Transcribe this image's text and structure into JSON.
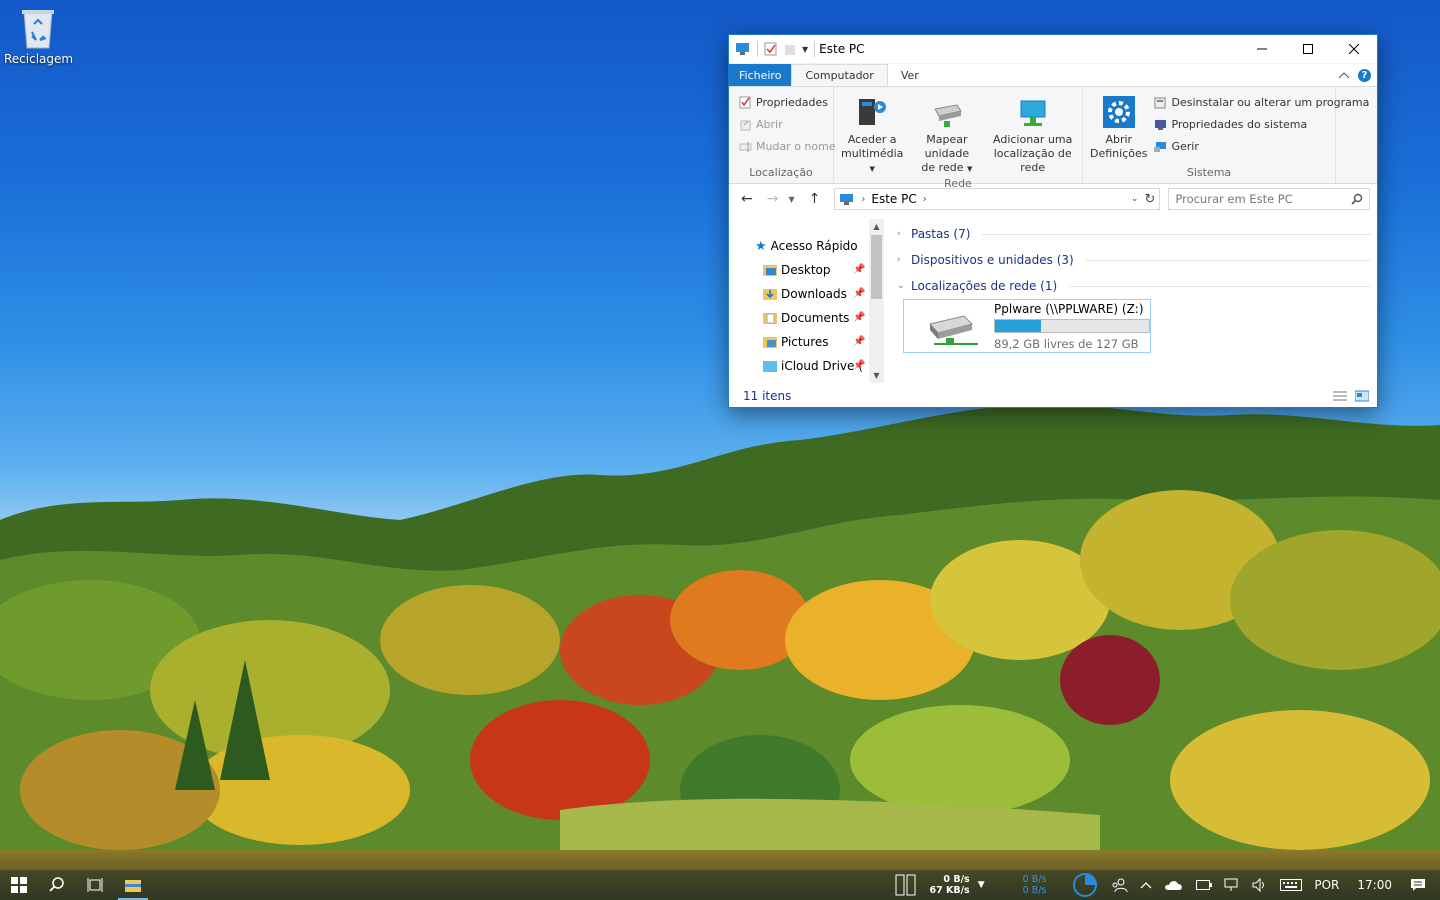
{
  "desktop": {
    "recycle_bin_label": "Reciclagem"
  },
  "window": {
    "title": "Este PC",
    "tabs": {
      "file": "Ficheiro",
      "computer": "Computador",
      "view": "Ver"
    },
    "ribbon": {
      "location": {
        "label": "Localização",
        "properties": "Propriedades",
        "open": "Abrir",
        "rename": "Mudar o nome"
      },
      "network": {
        "label": "Rede",
        "media_line1": "Aceder a",
        "media_line2": "multimédia",
        "map_line1": "Mapear unidade",
        "map_line2": "de rede",
        "add_line1": "Adicionar uma",
        "add_line2": "localização de rede"
      },
      "system": {
        "label": "Sistema",
        "settings_line1": "Abrir",
        "settings_line2": "Definições",
        "uninstall": "Desinstalar ou alterar um programa",
        "sys_props": "Propriedades do sistema",
        "manage": "Gerir"
      }
    },
    "address": {
      "crumb": "Este PC"
    },
    "search": {
      "placeholder": "Procurar em Este PC"
    },
    "nav_pane": {
      "quick_access": "Acesso Rápido",
      "items": [
        {
          "label": "Desktop"
        },
        {
          "label": "Downloads"
        },
        {
          "label": "Documents"
        },
        {
          "label": "Pictures"
        },
        {
          "label": "iCloud Drive ("
        }
      ]
    },
    "sections": {
      "folders": "Pastas (7)",
      "devices": "Dispositivos e unidades (3)",
      "network": "Localizações de rede (1)"
    },
    "drive": {
      "name": "Pplware (\\\\PPLWARE) (Z:)",
      "space": "89,2 GB livres de 127 GB",
      "used_fraction": 0.298
    },
    "status": {
      "items": "11 itens"
    }
  },
  "taskbar": {
    "net_up": "0 B/s",
    "net_down": "67 KB/s",
    "net2_up": "0 B/s",
    "net2_down": "0 B/s",
    "language": "POR",
    "time": "17:00"
  },
  "colors": {
    "accent": "#1979ca",
    "link": "#1e3287",
    "progress": "#26a0da"
  }
}
